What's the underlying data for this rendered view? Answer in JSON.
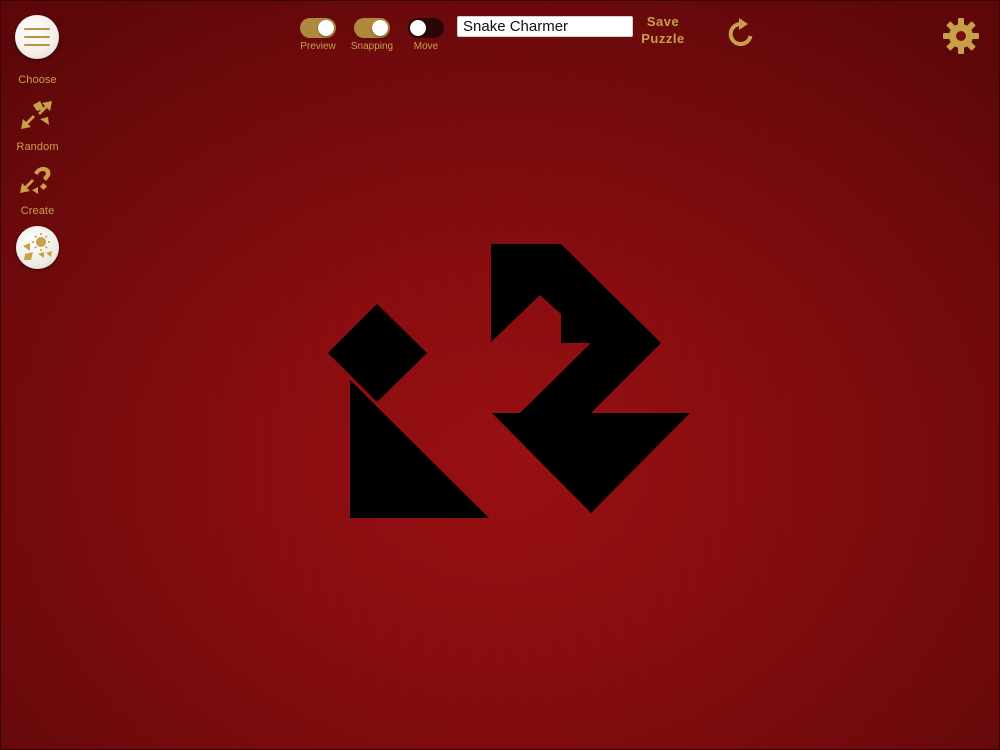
{
  "sidebar": {
    "menu_icon": "hamburger-menu-icon",
    "choose_label": "Choose",
    "choose_icon": "choose-arrows-icon",
    "random_label": "Random",
    "random_icon": "random-arrows-icon",
    "create_label": "Create",
    "create_icon": "create-puzzle-icon"
  },
  "toolbar": {
    "toggles": [
      {
        "label": "Preview",
        "on": true
      },
      {
        "label": "Snapping",
        "on": true
      },
      {
        "label": "Move",
        "on": false
      }
    ],
    "puzzle_name": "Snake Charmer",
    "save_label_line1": "Save",
    "save_label_line2": "Puzzle",
    "reset_icon": "reset-icon",
    "settings_icon": "gear-icon"
  },
  "colors": {
    "accent_gold": "#c9a04a",
    "background_red": "#8a0d10",
    "piece_black": "#000000"
  }
}
